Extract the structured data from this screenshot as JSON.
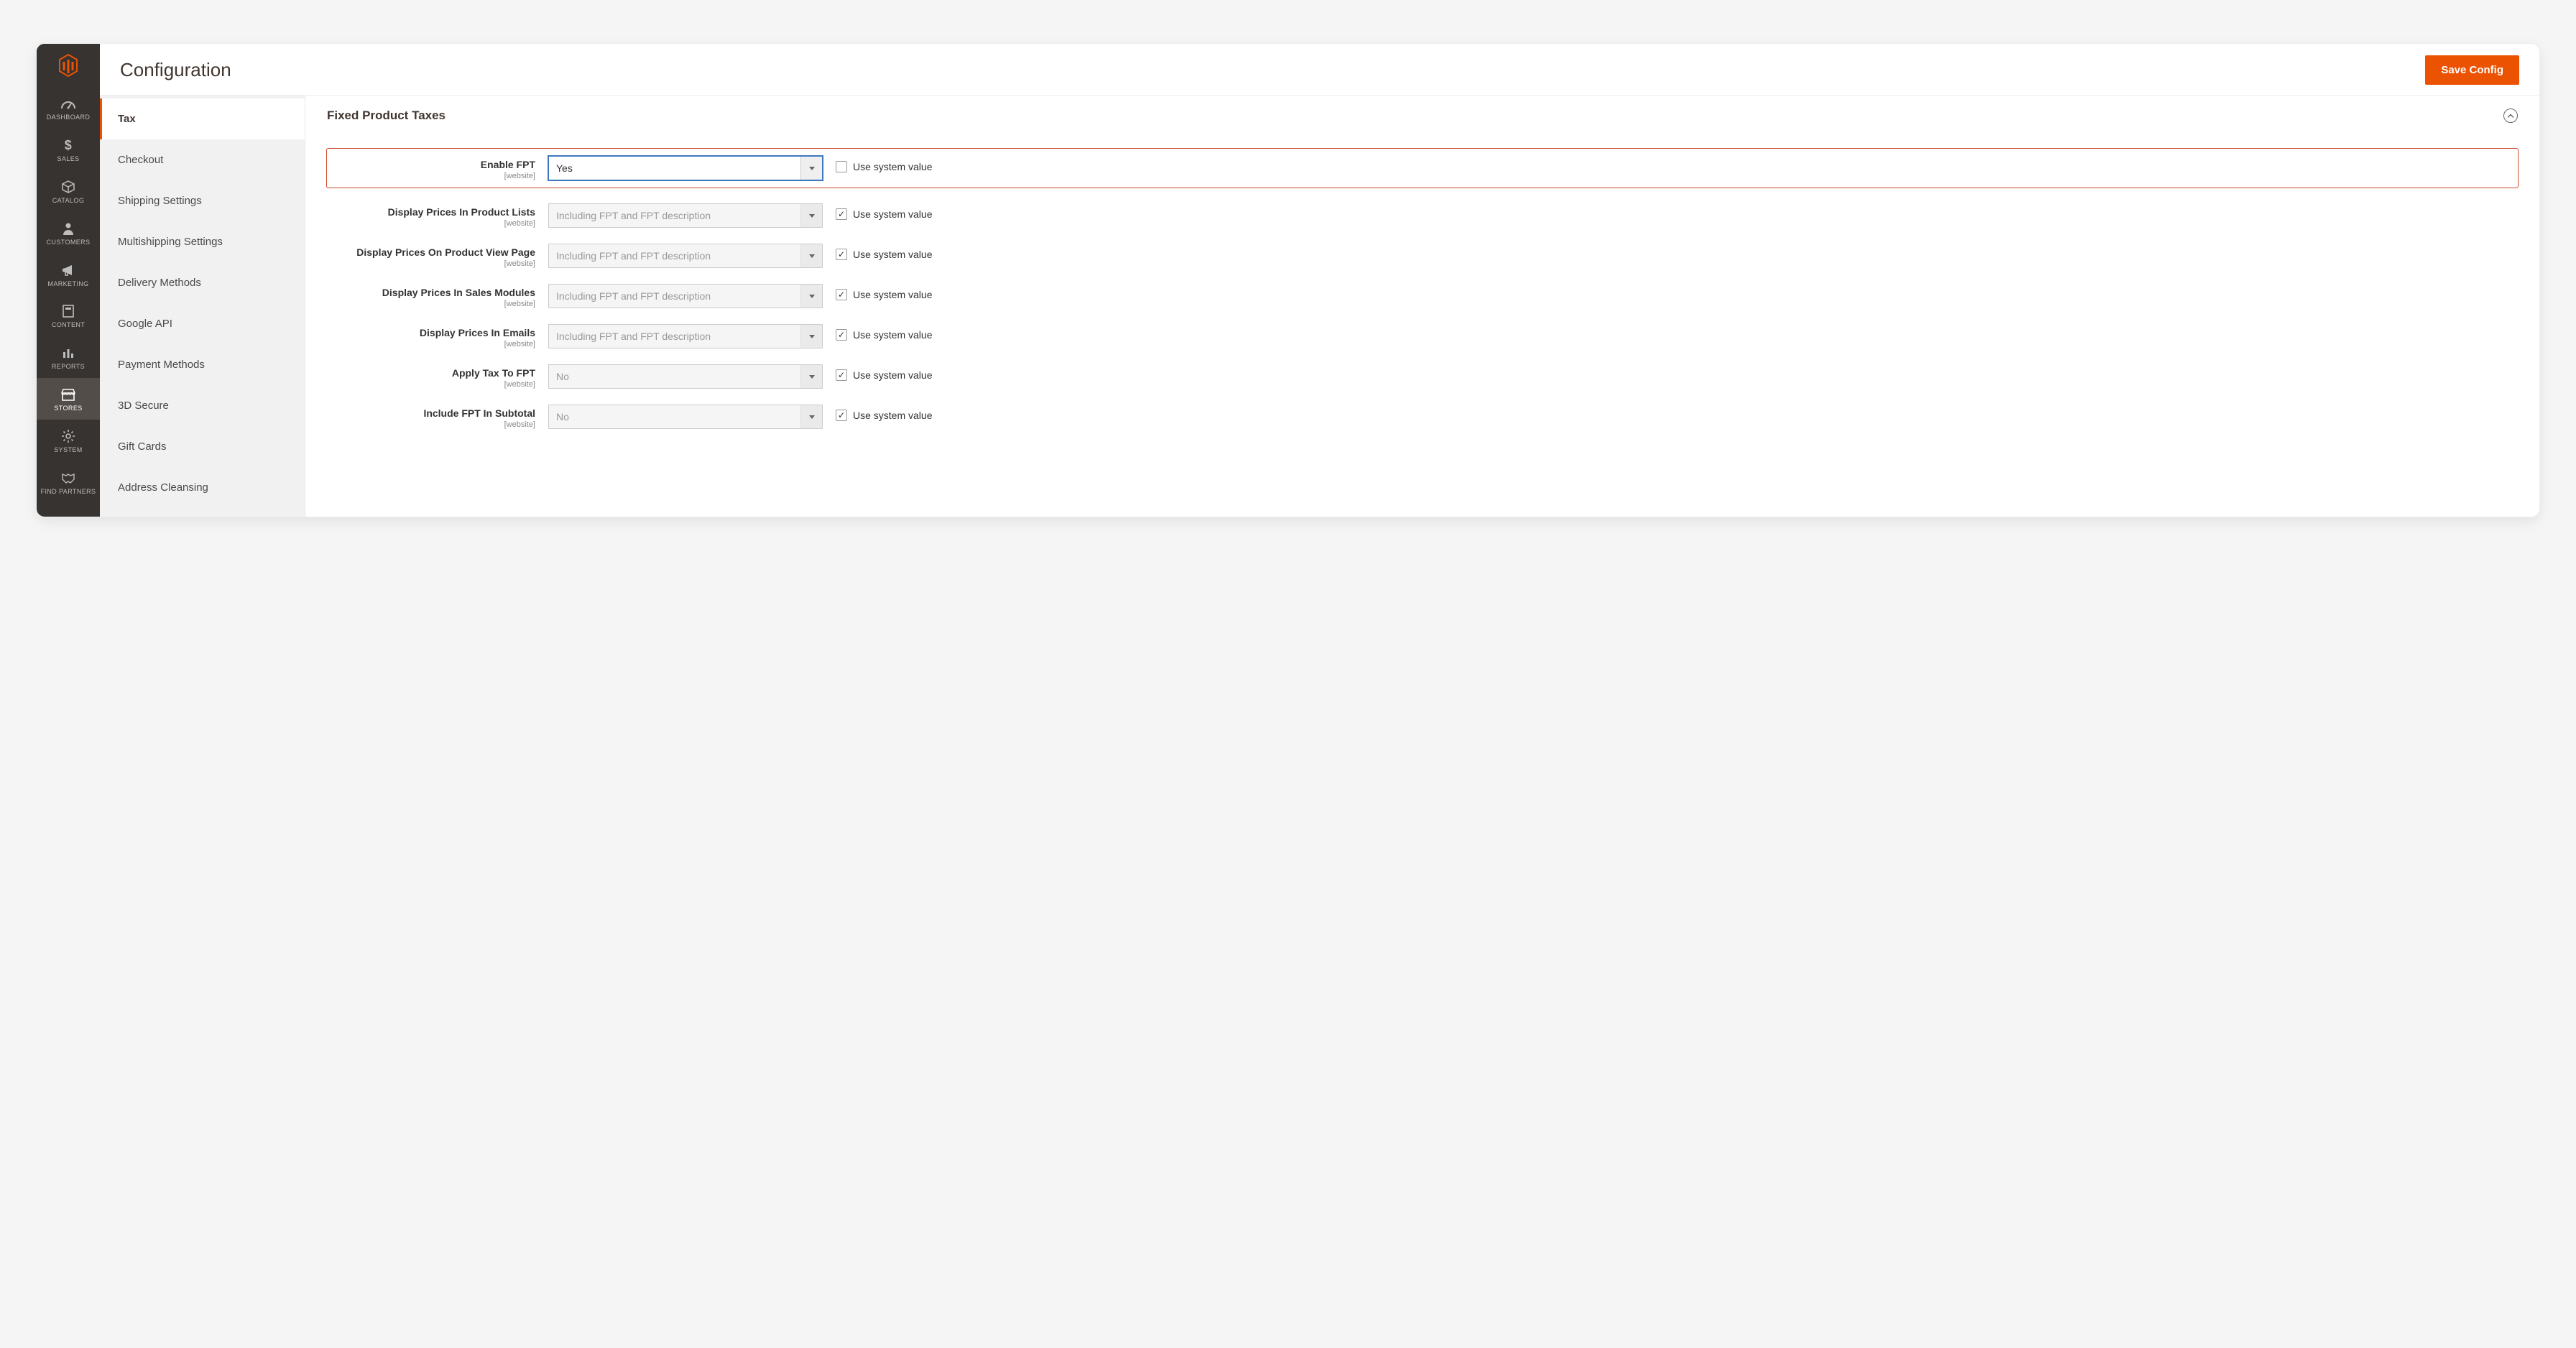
{
  "page": {
    "title": "Configuration",
    "save_button": "Save Config"
  },
  "admin_nav": [
    {
      "id": "dashboard",
      "label": "DASHBOARD",
      "icon": "gauge-icon",
      "active": false
    },
    {
      "id": "sales",
      "label": "SALES",
      "icon": "dollar-icon",
      "active": false
    },
    {
      "id": "catalog",
      "label": "CATALOG",
      "icon": "box-icon",
      "active": false
    },
    {
      "id": "customers",
      "label": "CUSTOMERS",
      "icon": "person-icon",
      "active": false
    },
    {
      "id": "marketing",
      "label": "MARKETING",
      "icon": "megaphone-icon",
      "active": false
    },
    {
      "id": "content",
      "label": "CONTENT",
      "icon": "page-icon",
      "active": false
    },
    {
      "id": "reports",
      "label": "REPORTS",
      "icon": "bars-icon",
      "active": false
    },
    {
      "id": "stores",
      "label": "STORES",
      "icon": "storefront-icon",
      "active": true
    },
    {
      "id": "system",
      "label": "SYSTEM",
      "icon": "gear-icon",
      "active": false
    },
    {
      "id": "find-partners",
      "label": "FIND PARTNERS",
      "icon": "handshake-icon",
      "active": false
    }
  ],
  "settings_nav": [
    {
      "id": "tax",
      "label": "Tax",
      "active": true
    },
    {
      "id": "checkout",
      "label": "Checkout",
      "active": false
    },
    {
      "id": "shipping-settings",
      "label": "Shipping Settings",
      "active": false
    },
    {
      "id": "multishipping-settings",
      "label": "Multishipping Settings",
      "active": false
    },
    {
      "id": "delivery-methods",
      "label": "Delivery Methods",
      "active": false
    },
    {
      "id": "google-api",
      "label": "Google API",
      "active": false
    },
    {
      "id": "payment-methods",
      "label": "Payment Methods",
      "active": false
    },
    {
      "id": "3d-secure",
      "label": "3D Secure",
      "active": false
    },
    {
      "id": "gift-cards",
      "label": "Gift Cards",
      "active": false
    },
    {
      "id": "address-cleansing",
      "label": "Address Cleansing",
      "active": false
    }
  ],
  "section": {
    "title": "Fixed Product Taxes",
    "scope_label": "[website]",
    "use_system_label": "Use system value",
    "fields": [
      {
        "id": "enable-fpt",
        "label": "Enable FPT",
        "value": "Yes",
        "disabled": false,
        "use_system": false,
        "highlight": true
      },
      {
        "id": "display-prices-product-lists",
        "label": "Display Prices In Product Lists",
        "value": "Including FPT and FPT description",
        "disabled": true,
        "use_system": true,
        "highlight": false
      },
      {
        "id": "display-prices-product-view",
        "label": "Display Prices On Product View Page",
        "value": "Including FPT and FPT description",
        "disabled": true,
        "use_system": true,
        "highlight": false
      },
      {
        "id": "display-prices-sales-modules",
        "label": "Display Prices In Sales Modules",
        "value": "Including FPT and FPT description",
        "disabled": true,
        "use_system": true,
        "highlight": false
      },
      {
        "id": "display-prices-emails",
        "label": "Display Prices In Emails",
        "value": "Including FPT and FPT description",
        "disabled": true,
        "use_system": true,
        "highlight": false
      },
      {
        "id": "apply-tax-to-fpt",
        "label": "Apply Tax To FPT",
        "value": "No",
        "disabled": true,
        "use_system": true,
        "highlight": false
      },
      {
        "id": "include-fpt-subtotal",
        "label": "Include FPT In Subtotal",
        "value": "No",
        "disabled": true,
        "use_system": true,
        "highlight": false
      }
    ]
  }
}
